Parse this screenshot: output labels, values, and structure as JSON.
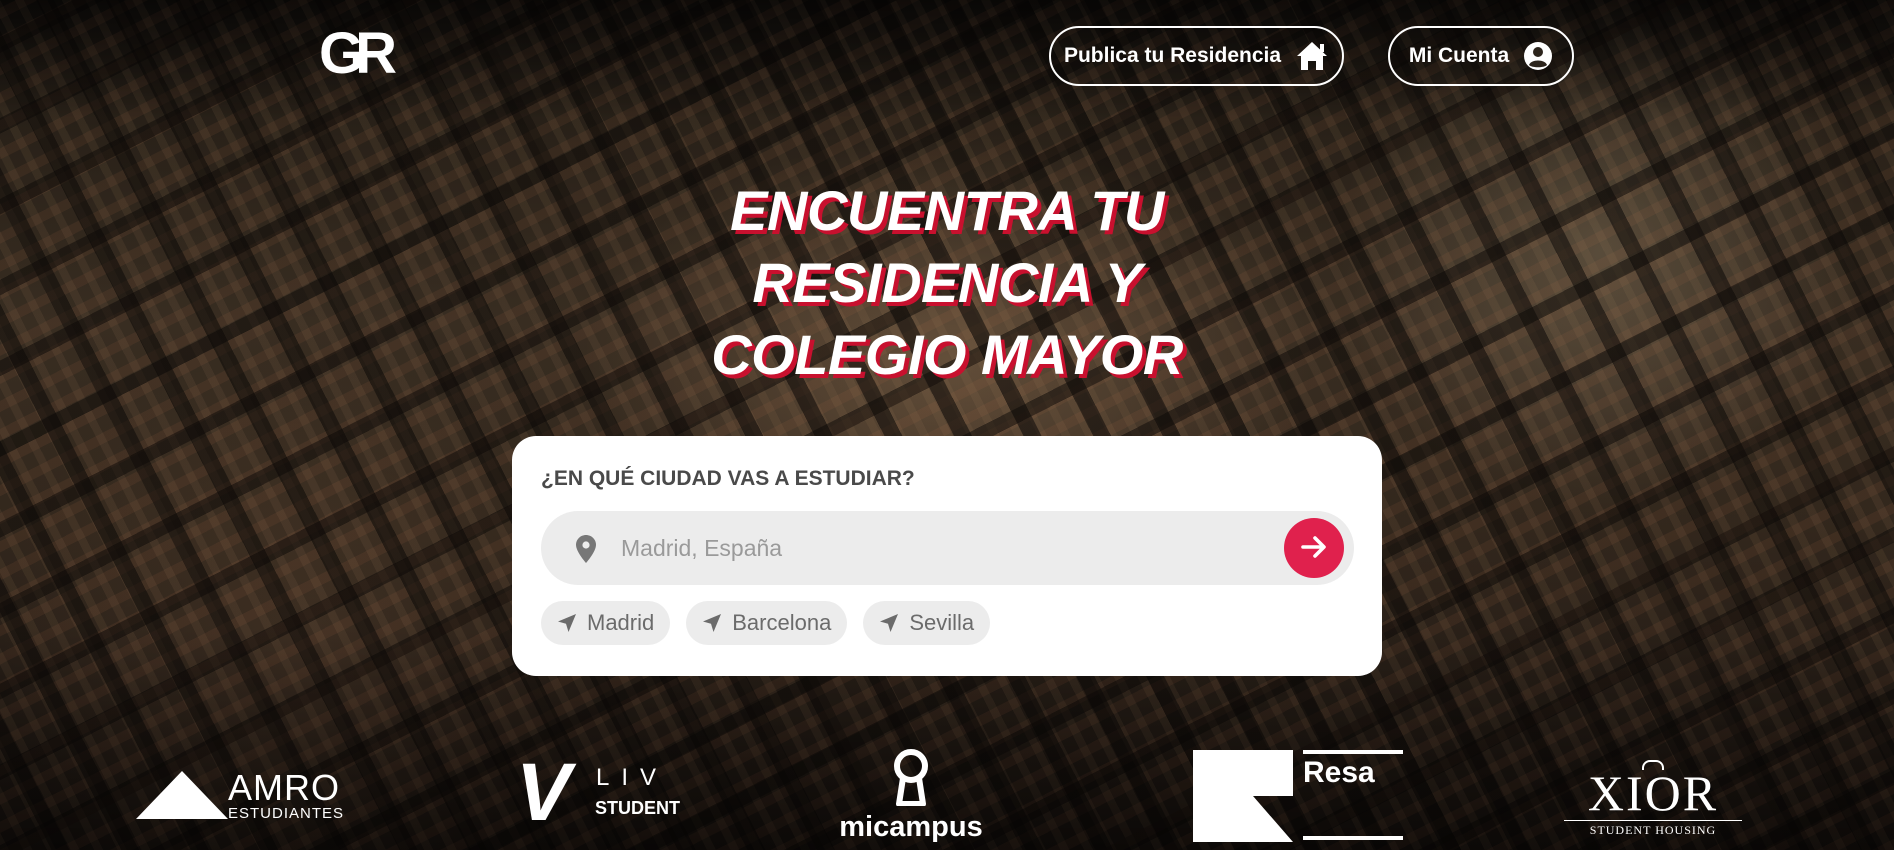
{
  "header": {
    "logo_text": "GR",
    "publish_label": "Publica tu Residencia",
    "account_label": "Mi Cuenta"
  },
  "hero": {
    "title_lines": [
      "ENCUENTRA TU",
      "RESIDENCIA Y",
      "COLEGIO MAYOR"
    ]
  },
  "search": {
    "label": "¿EN QUÉ CIUDAD VAS A ESTUDIAR?",
    "placeholder": "Madrid, España",
    "value": "",
    "suggestions": [
      "Madrid",
      "Barcelona",
      "Sevilla"
    ]
  },
  "partners": {
    "amro": {
      "name": "AMRO",
      "sub": "ESTUDIANTES"
    },
    "liv": {
      "mark": "V",
      "line1": "LIV",
      "line2": "STUDENT"
    },
    "micampus": {
      "name": "micampus"
    },
    "resa": {
      "name": "Resa"
    },
    "xior": {
      "name": "XIOR",
      "sub": "STUDENT HOUSING"
    }
  },
  "colors": {
    "accent": "#e0214d",
    "title_shadow": "#c8102e",
    "card_bg": "#ffffff",
    "field_bg": "#ececec"
  },
  "icons": {
    "publish": "house-icon",
    "account": "user-circle-icon",
    "field": "map-pin-icon",
    "submit": "arrow-right-icon",
    "chip": "location-arrow-icon"
  }
}
